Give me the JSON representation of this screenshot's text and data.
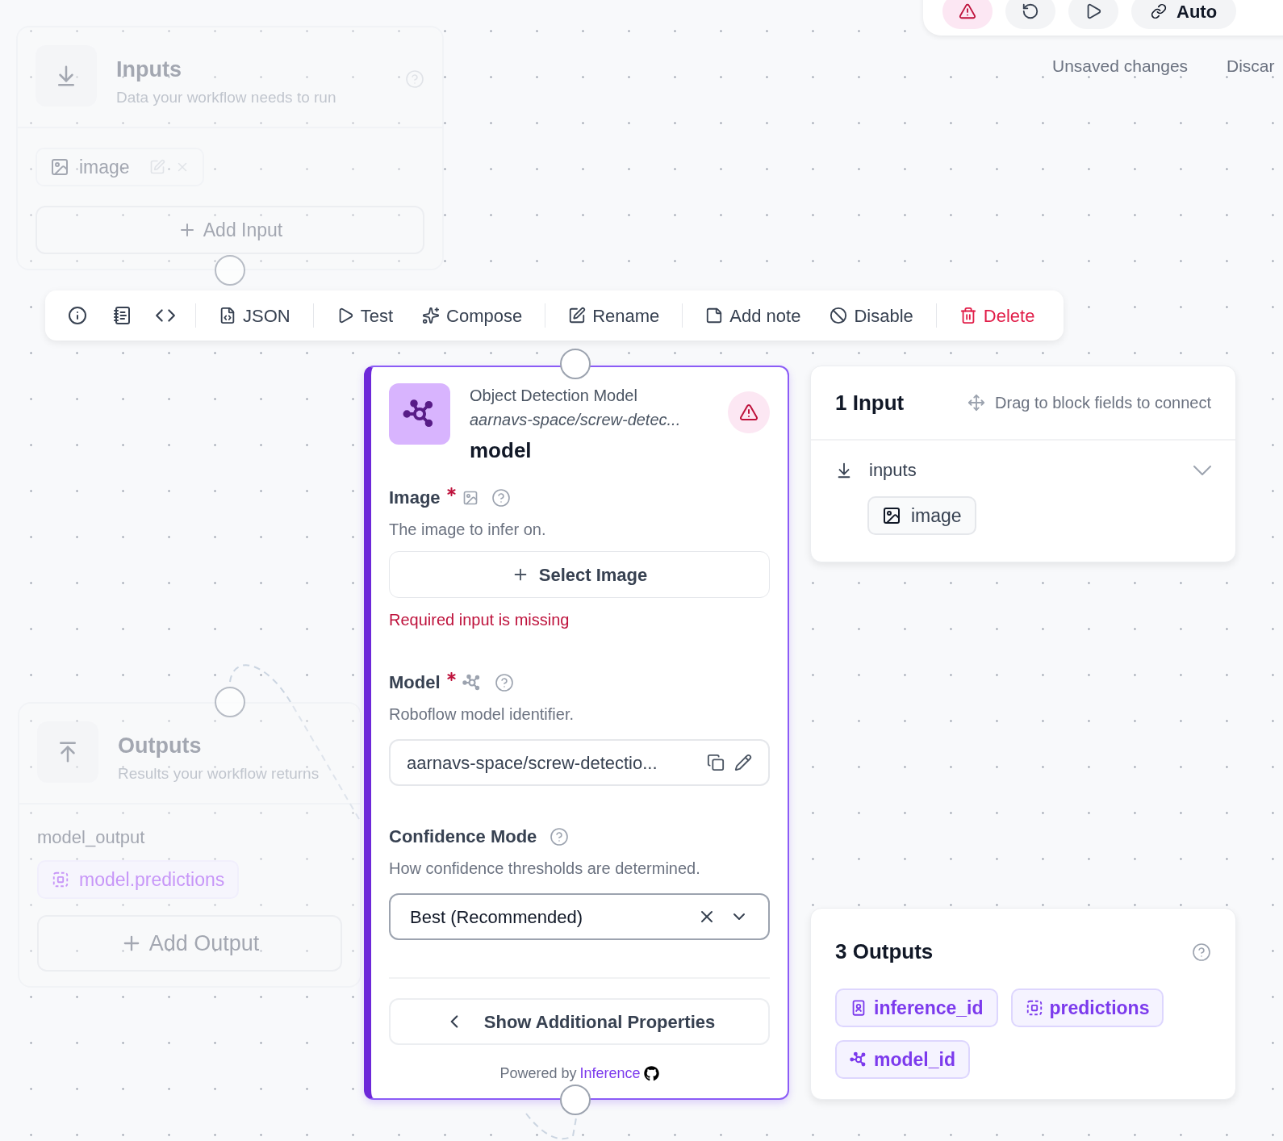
{
  "top_bar": {
    "mode": "Auto",
    "status": "Unsaved changes",
    "discard": "Discar",
    "warning": true
  },
  "inputs_node": {
    "title": "Inputs",
    "subtitle": "Data your workflow needs to run",
    "items": [
      {
        "label": "image"
      }
    ],
    "add_label": "Add Input"
  },
  "toolbar": {
    "items": [
      {
        "label": "JSON",
        "kind": "normal"
      },
      {
        "label": "Test",
        "kind": "normal"
      },
      {
        "label": "Compose",
        "kind": "normal"
      },
      {
        "label": "Rename",
        "kind": "normal"
      },
      {
        "label": "Add note",
        "kind": "normal"
      },
      {
        "label": "Disable",
        "kind": "normal"
      },
      {
        "label": "Delete",
        "kind": "danger"
      }
    ]
  },
  "model_node": {
    "type_label": "Object Detection Model",
    "model_path": "aarnavs-space/screw-detec...",
    "name": "model",
    "warning": true,
    "fields": [
      {
        "kind": "image",
        "label": "Image",
        "required": true,
        "description": "The image to infer on.",
        "button": "Select Image",
        "error": "Required input is missing"
      },
      {
        "kind": "model",
        "label": "Model",
        "required": true,
        "description": "Roboflow model identifier.",
        "value": "aarnavs-space/screw-detectio..."
      },
      {
        "kind": "select",
        "label": "Confidence Mode",
        "required": false,
        "description": "How confidence thresholds are determined.",
        "value": "Best (Recommended)"
      }
    ],
    "more_button": "Show Additional Properties",
    "footer_prefix": "Powered by",
    "footer_link": "Inference"
  },
  "input_panel": {
    "title": "1 Input",
    "hint": "Drag to block fields to connect",
    "groups": [
      {
        "label": "inputs",
        "expanded": true,
        "items": [
          {
            "label": "image"
          }
        ]
      }
    ]
  },
  "outputs_panel": {
    "title": "3 Outputs",
    "items": [
      {
        "label": "inference_id"
      },
      {
        "label": "predictions"
      },
      {
        "label": "model_id"
      }
    ]
  },
  "outputs_node": {
    "title": "Outputs",
    "subtitle": "Results your workflow returns",
    "outputs": [
      {
        "name": "model_output",
        "selector": "model.predictions"
      }
    ],
    "add_label": "Add Output"
  }
}
